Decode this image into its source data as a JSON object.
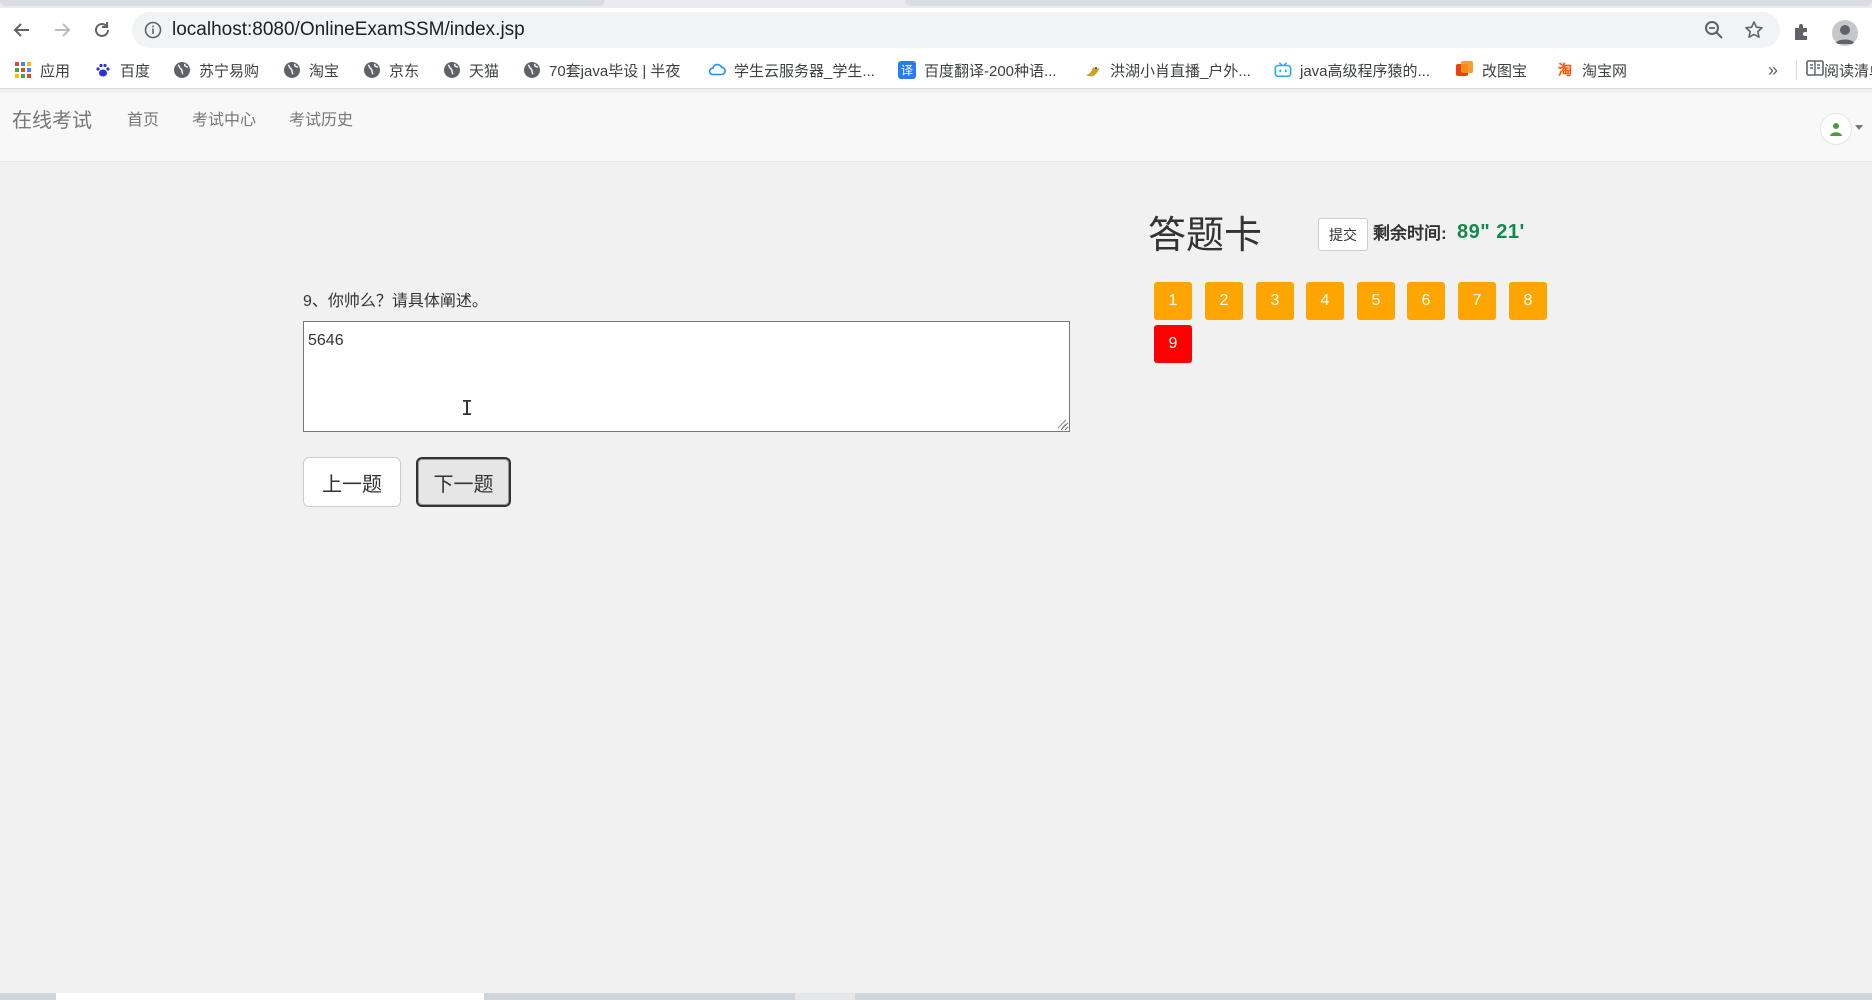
{
  "browser": {
    "url": "localhost:8080/OnlineExamSSM/index.jsp",
    "bookmarks": [
      {
        "label": "应用",
        "icon": "apps-grid-icon"
      },
      {
        "label": "百度",
        "icon": "baidu-paw-icon"
      },
      {
        "label": "苏宁易购",
        "icon": "globe-icon"
      },
      {
        "label": "淘宝",
        "icon": "globe-icon"
      },
      {
        "label": "京东",
        "icon": "globe-icon"
      },
      {
        "label": "天猫",
        "icon": "globe-icon"
      },
      {
        "label": "70套java毕设 | 半夜",
        "icon": "globe-icon"
      },
      {
        "label": "学生云服务器_学生...",
        "icon": "cloud-icon"
      },
      {
        "label": "百度翻译-200种语...",
        "icon": "translate-icon"
      },
      {
        "label": "洪湖小肖直播_户外...",
        "icon": "bird-icon"
      },
      {
        "label": "java高级程序猿的...",
        "icon": "bilibili-tv-icon"
      },
      {
        "label": "改图宝",
        "icon": "image-editor-icon"
      },
      {
        "label": "淘宝网",
        "icon": "taobao-icon"
      }
    ],
    "more_bookmarks": "»",
    "reading_list": "阅读清单"
  },
  "navbar": {
    "brand": "在线考试",
    "links": [
      "首页",
      "考试中心",
      "考试历史"
    ]
  },
  "question": {
    "text": "9、你帅么？请具体阐述。",
    "answer": "5646",
    "prev_label": "上一题",
    "next_label": "下一题"
  },
  "answer_card": {
    "title": "答题卡",
    "submit_label": "提交",
    "remaining_label": "剩余时间:",
    "remaining_time": "89\" 21'",
    "items": [
      {
        "n": "1",
        "state": "answered"
      },
      {
        "n": "2",
        "state": "answered"
      },
      {
        "n": "3",
        "state": "answered"
      },
      {
        "n": "4",
        "state": "answered"
      },
      {
        "n": "5",
        "state": "answered"
      },
      {
        "n": "6",
        "state": "answered"
      },
      {
        "n": "7",
        "state": "answered"
      },
      {
        "n": "8",
        "state": "answered"
      },
      {
        "n": "9",
        "state": "current"
      }
    ]
  },
  "colors": {
    "answered": "#ffa500",
    "current": "#ff0000",
    "timer": "#138a4c",
    "page_bg": "#f1f1f1"
  }
}
